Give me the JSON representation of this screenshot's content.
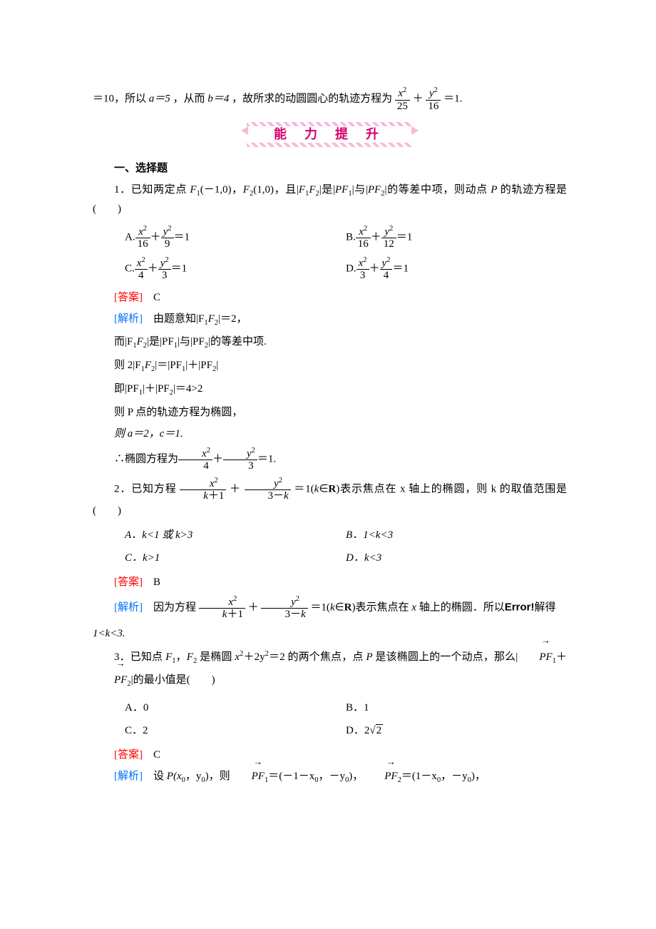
{
  "top_para": {
    "prefix": "＝10，所以 ",
    "a_eq": "a＝5",
    "mid1": "，从而 ",
    "b_eq": "b＝4",
    "mid2": "，故所求的动圆圆心的轨迹方程为",
    "frac1_num": "x",
    "frac1_den": "25",
    "plus": "＋",
    "frac2_num": "y",
    "frac2_den": "16",
    "eq1": "＝1."
  },
  "banner": "能 力 提 升",
  "section1": "一、选择题",
  "q1": {
    "stem_pre": "1．已知两定点 ",
    "f1": "F",
    "f1_args": "(－1,0)",
    "comma": "，",
    "f2": "F",
    "f2_args": "(1,0)",
    "mid": "，且|",
    "f1f2": "F",
    "f1f2_2": "F",
    "mid2": "|是|",
    "pf1": "PF",
    "mid3": "|与|",
    "pf2": "PF",
    "mid4": "|的等差中项，则动点 ",
    "p": "P",
    "mid5": " 的轨迹方程是(　　)",
    "optA_label": "A.",
    "optA_d1": "16",
    "optA_d2": "9",
    "optB_label": "B.",
    "optB_d1": "16",
    "optB_d2": "12",
    "optC_label": "C.",
    "optC_d1": "4",
    "optC_d2": "3",
    "optD_label": "D.",
    "optD_d1": "3",
    "optD_d2": "4",
    "ans_label": "[答案]",
    "ans": "C",
    "ana_label": "[解析]",
    "ana1": "由题意知|F",
    "ana1b": "F",
    "ana1c": "|＝2，",
    "ana2a": "而|F",
    "ana2b": "F",
    "ana2c": "|是|PF",
    "ana2d": "|与|PF",
    "ana2e": "|的等差中项.",
    "ana3a": "则 2|F",
    "ana3b": "F",
    "ana3c": "|＝|PF",
    "ana3d": "|＋|PF",
    "ana3e": "|",
    "ana4a": "即|PF",
    "ana4b": "|＋|PF",
    "ana4c": "|＝4>2",
    "ana5": "则 P 点的轨迹方程为椭圆，",
    "ana6": "则 a＝2，c＝1.",
    "ana7_pre": "∴椭圆方程为",
    "ana7_d1": "4",
    "ana7_d2": "3",
    "ana7_post": "＝1."
  },
  "q2": {
    "stem_pre": "2．已知方程",
    "d1a": "k",
    "d1b": "＋1",
    "d2a": "3－",
    "d2b": "k",
    "stem_mid": "＝1(",
    "k": "k",
    "in": "∈",
    "R": "R",
    "stem_post": ")表示焦点在 x 轴上的椭圆，则 k 的取值范围是(　　)",
    "optA": "A．k<1 或 k>3",
    "optB": "B．1<k<3",
    "optC": "C．k>1",
    "optD": "D．k<3",
    "ans_label": "[答案]",
    "ans": "B",
    "ana_label": "[解析]",
    "ana_pre": "因为方程",
    "ana_mid": "＝1(",
    "ana_post1": ")表示焦点在 ",
    "x": "x",
    "ana_post2": " 轴上的椭圆．所以",
    "err": "Error!",
    "ana_post3": "解得",
    "ana_end": "1<k<3."
  },
  "q3": {
    "stem_pre": "3．已知点 ",
    "f1": "F",
    "f2": "F",
    "stem_mid1": " 是椭圆 ",
    "eq": "x",
    "eq2": "＋2y",
    "eq3": "＝2",
    "stem_mid2": " 的两个焦点，点 ",
    "p": "P",
    "stem_mid3": " 是该椭圆上的一个动点，那么|",
    "pf1": "PF",
    "plus": "＋",
    "pf2": "PF",
    "stem_post": "|的最小值是(　　)",
    "optA": "A．0",
    "optB": "B．1",
    "optC": "C．2",
    "optD_pre": "D．2",
    "optD_rad": "2",
    "ans_label": "[答案]",
    "ans": "C",
    "ana_label": "[解析]",
    "ana_pre": "设 ",
    "px": "P(x",
    "py": "，y",
    "close": ")",
    "ana_mid": "，则",
    "pf1v": "PF",
    "eq1": "＝(－1－x",
    "eq1b": "，－y",
    "eq1c": ")，",
    "pf2v": "PF",
    "eq2a": "＝(1－x",
    "eq2b": "，－y",
    "eq2c": ")，"
  }
}
